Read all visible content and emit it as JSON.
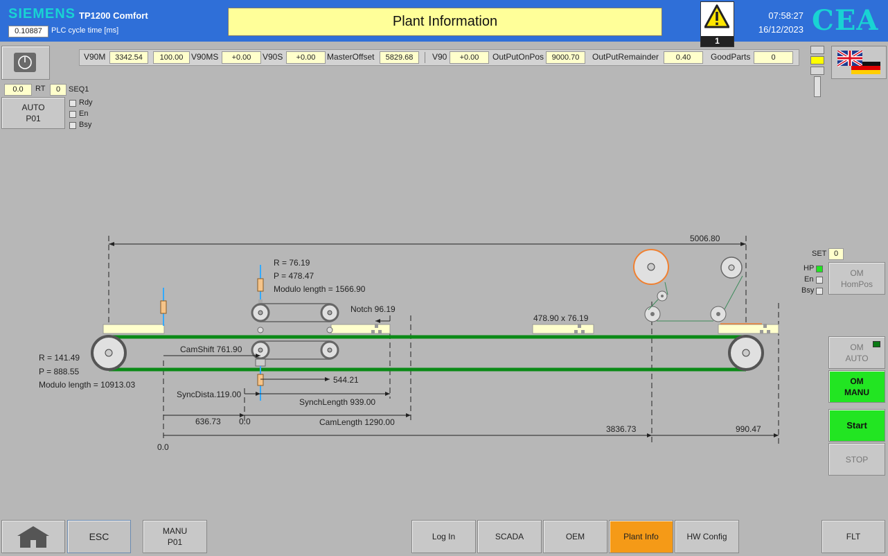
{
  "header": {
    "brand": "SIEMENS",
    "model": "TP1200 Comfort",
    "cycle_value": "0.10887",
    "cycle_label": "PLC cycle time [ms]",
    "title": "Plant Information",
    "alarm_count": "1",
    "time": "07:58:27",
    "date": "16/12/2023",
    "logo": "CEA"
  },
  "params": {
    "v90m_label": "V90M",
    "v90m_value": "3342.54",
    "v90m_pct": "100.00",
    "v90ms_label": "V90MS",
    "v90ms_value": "+0.00",
    "v90s_label": "V90S",
    "v90s_value": "+0.00",
    "master_offset_label": "MasterOffset",
    "master_offset_value": "5829.68",
    "v90_label": "V90",
    "v90_value": "+0.00",
    "output_onpos_label": "OutPutOnPos",
    "output_onpos_value": "9000.70",
    "output_remainder_label": "OutPutRemainder",
    "output_remainder_value": "0.40",
    "goodparts_label": "GoodParts",
    "goodparts_value": "0"
  },
  "left_panel": {
    "val1": "0.0",
    "rt_label": "RT",
    "val2": "0",
    "seq_label": "SEQ1",
    "auto_line1": "AUTO",
    "auto_line2": "P01",
    "rdy": "Rdy",
    "en": "En",
    "bsy": "Bsy"
  },
  "right_panel": {
    "set_label": "SET",
    "set_value": "0",
    "hp": "HP",
    "en": "En",
    "bsy": "Bsy",
    "om_hompos_1": "OM",
    "om_hompos_2": "HomPos",
    "om_auto_1": "OM",
    "om_auto_2": "AUTO",
    "om_manu_1": "OM",
    "om_manu_2": "MANU",
    "start": "Start",
    "stop": "STOP"
  },
  "diagram": {
    "total_length": "5006.80",
    "r_small": "R = 76.19",
    "p_small": "P = 478.47",
    "modulo_small": "Modulo length = 1566.90",
    "notch": "Notch 96.19",
    "label_size": "478.90 x 76.19",
    "r_big": "R = 141.49",
    "p_big": "P = 888.55",
    "modulo_big": "Modulo length = 10913.03",
    "camshift": "CamShift 761.90",
    "val_544": "544.21",
    "syncdista": "SyncDista.119.00",
    "synchlength": "SynchLength 939.00",
    "val_636": "636.73",
    "zero_a": "0.0",
    "camlength": "CamLength 1290.00",
    "val_3836": "3836.73",
    "val_990": "990.47",
    "zero_b": "0.0"
  },
  "footer": {
    "esc": "ESC",
    "manu_1": "MANU",
    "manu_2": "P01",
    "login": "Log In",
    "scada": "SCADA",
    "oem": "OEM",
    "plant_info": "Plant Info",
    "hw_config": "HW Config",
    "flt": "FLT"
  },
  "colors": {
    "header_blue": "#2f6fd8",
    "brand_cyan": "#19d3d3",
    "active_orange": "#f59a17",
    "start_green": "#22e522",
    "belt_green": "#0a8a16"
  }
}
